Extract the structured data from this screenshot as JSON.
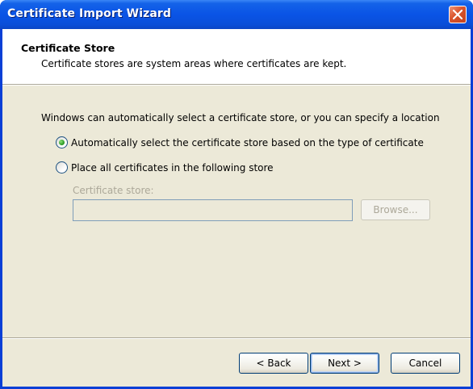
{
  "window": {
    "title": "Certificate Import Wizard"
  },
  "header": {
    "title": "Certificate Store",
    "subtitle": "Certificate stores are system areas where certificates are kept."
  },
  "body": {
    "intro": "Windows can automatically select a certificate store, or you can specify a location",
    "options": [
      {
        "label": "Automatically select the certificate store based on the type of certificate",
        "checked": true
      },
      {
        "label": "Place all certificates in the following store",
        "checked": false
      }
    ],
    "store": {
      "label": "Certificate store:",
      "value": "",
      "enabled": false
    },
    "browse_label": "Browse..."
  },
  "footer": {
    "back_label": "< Back",
    "next_label": "Next >",
    "cancel_label": "Cancel"
  },
  "colors": {
    "title_bar": "#0a54e6",
    "dialog_bg": "#ece9d8",
    "disabled_text": "#aca899",
    "radio_checked": "#2f9d27"
  }
}
